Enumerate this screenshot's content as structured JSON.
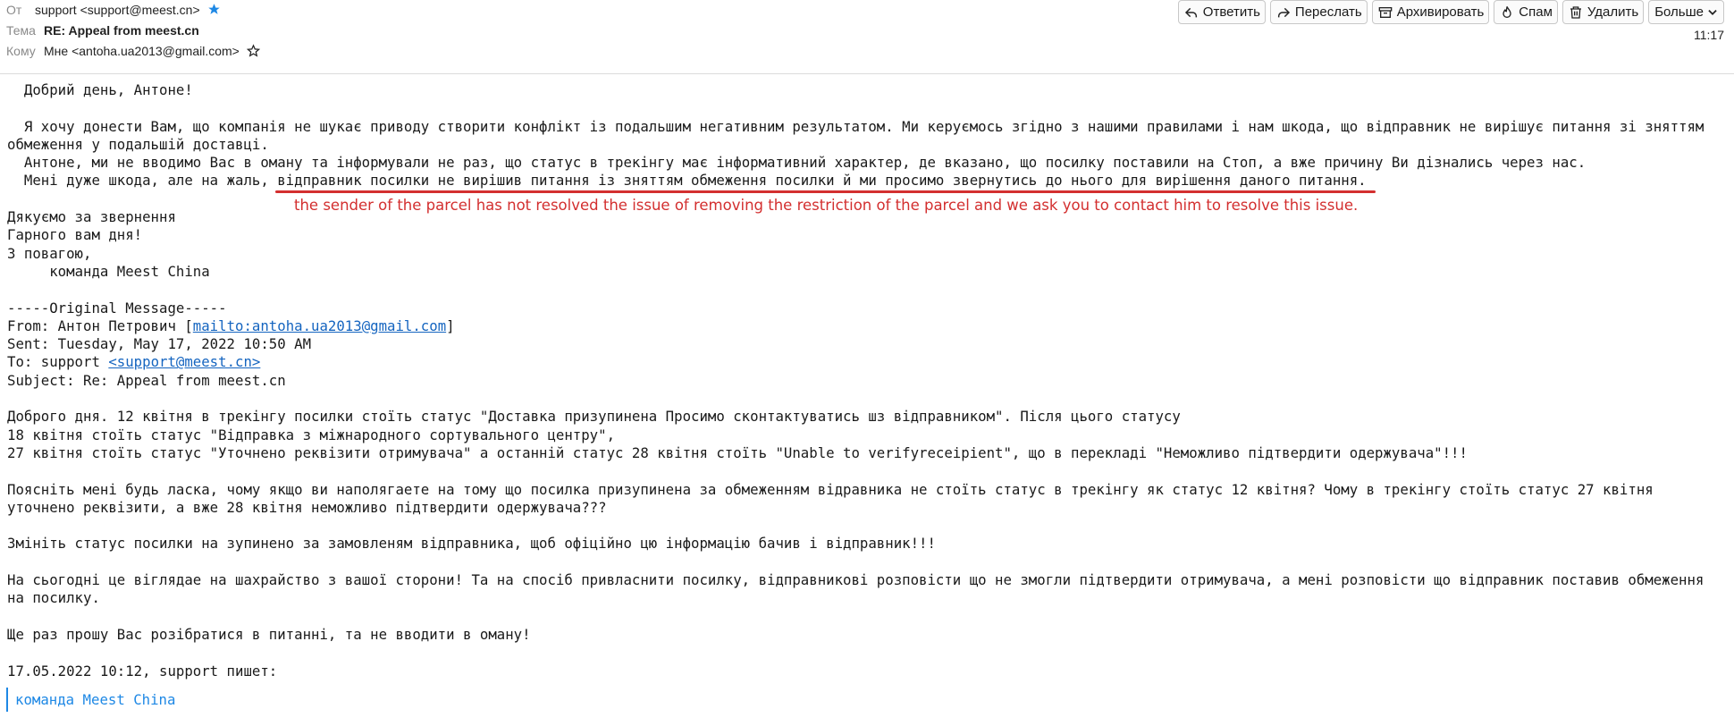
{
  "header": {
    "from_label": "От",
    "from_value": "support <support@meest.cn>",
    "subject_label": "Тема",
    "subject_value": "RE: Appeal from meest.cn",
    "to_label": "Кому",
    "to_value": "Мне <antoha.ua2013@gmail.com>",
    "time": "11:17"
  },
  "toolbar": {
    "reply": "Ответить",
    "forward": "Переслать",
    "archive": "Архивировать",
    "spam": "Спам",
    "delete": "Удалить",
    "more": "Больше"
  },
  "body": {
    "greeting": "Добрий день, Антоне!",
    "p1": "Я хочу донести Вам, що компанія не шукає приводу створити конфлікт із подальшим негативним результатом. Ми керуємось згідно з нашими правилами і нам шкода, що відправник не вирішує питання зі зняттям обмеження у подальшій доставці.",
    "p2": "Антоне, ми не вводимо Вас в оману та інформували не раз, що статус в трекінгу має інформативний характер, де вказано, що посилку поставили на Стоп, а вже причину Ви дізнались через нас.",
    "p3_before": "Мені дуже шкода, але на жаль, ",
    "p3_highlight": "відправник посилки не вирішив питання із зняттям обмеження посилки й ми просимо звернутись до нього для вирішення даного питання.",
    "annotation": "the sender of the parcel has not resolved the issue of removing the restriction of the parcel and we ask you to contact him to resolve this issue.",
    "sig1": "Дякуємо за звернення",
    "sig2": "Гарного вам дня!",
    "sig3": "З повагою,",
    "sig4": "команда Meest China",
    "orig_sep": "-----Original Message-----",
    "orig_from_prefix": "From: Антон Петрович [",
    "orig_from_link": "mailto:antoha.ua2013@gmail.com",
    "orig_from_suffix": "]",
    "orig_sent": "Sent: Tuesday, May 17, 2022 10:50 AM",
    "orig_to_prefix": "To: support ",
    "orig_to_link": "<support@meest.cn>",
    "orig_subject": "Subject: Re: Appeal from meest.cn",
    "q1": "Доброго дня. 12 квітня в трекінгу посилки стоїть статус \"Доставка призупинена Просимо сконтактуватись шз відправником\". Після цього статусу",
    "q2": "18 квітня стоїть статус \"Відправка з міжнародного сортувального центру\",",
    "q3": "27 квітня стоїть статус \"Уточнено реквізити отримувача\" а останній статус 28 квітня стоїть \"Unable to verifyreceipient\", що в перекладі \"Неможливо підтвердити одержувача\"!!!",
    "q4": "Поясніть мені будь ласка, чому якщо ви наполягаете на тому що посилка призупинена за обмеженням відравника не стоїть статус в трекінгу як статус 12 квітня? Чому в трекінгу стоїть статус 27 квітня уточнено реквізити, а вже 28 квітня неможливо підтвердити одержувача???",
    "q5": "Змініть статус посилки на зупинено за замовленям відправника, щоб офіційно цю інформацію бачив і відправник!!!",
    "q6": "На сьогодні це віглядае на шахрайство з вашої сторони! Та на спосіб привласнити посилку, відправникові розповісти що не змогли підтвердити отримувача, а мені розповісти що відправник поставив обмеження на посилку.",
    "q7": "Ще раз прошу Вас розібратися в питанні, та не вводити в оману!",
    "q8": "17.05.2022 10:12, support пишет:",
    "quoted_sig": "команда Meest China"
  },
  "colors": {
    "annotation": "#d32f2f",
    "link": "#1565c0",
    "quote": "#1e88e5",
    "star": "#1e88e5"
  },
  "icons": [
    "star-filled-icon",
    "star-outline-icon",
    "reply-icon",
    "forward-icon",
    "archive-icon",
    "spam-icon",
    "trash-icon",
    "chevron-down-icon"
  ]
}
